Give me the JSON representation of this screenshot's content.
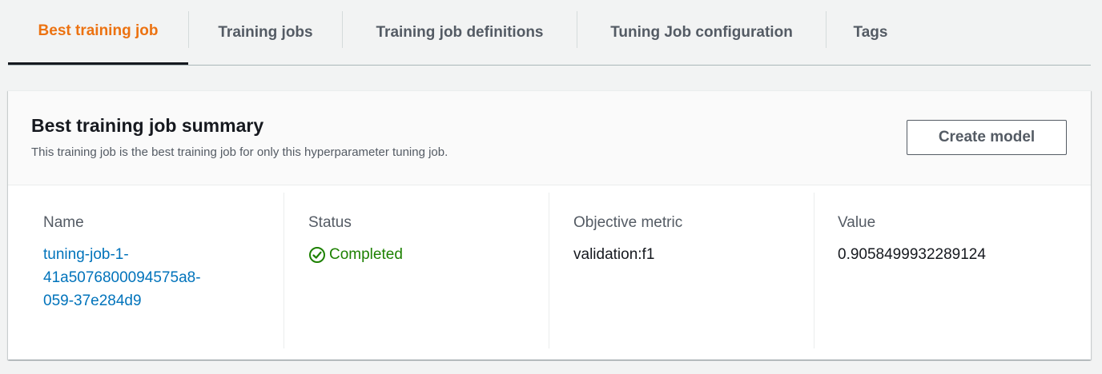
{
  "tabs": [
    {
      "label": "Best training job",
      "active": true
    },
    {
      "label": "Training jobs",
      "active": false
    },
    {
      "label": "Training job definitions",
      "active": false
    },
    {
      "label": "Tuning Job configuration",
      "active": false
    },
    {
      "label": "Tags",
      "active": false
    }
  ],
  "summary": {
    "title": "Best training job summary",
    "description": "This training job is the best training job for only this hyperparameter tuning job.",
    "create_model_label": "Create model"
  },
  "fields": {
    "name_label": "Name",
    "name_value_lines": [
      "tuning-job-1-",
      "41a5076800094575a8-",
      "059-37e284d9"
    ],
    "status_label": "Status",
    "status_value": "Completed",
    "objective_label": "Objective metric",
    "objective_value": "validation:f1",
    "value_label": "Value",
    "value_value": "0.9058499932289124"
  },
  "colors": {
    "active_tab": "#ec7211",
    "link": "#0073bb",
    "success": "#1d8102",
    "status_icon": "check-circle-icon"
  }
}
